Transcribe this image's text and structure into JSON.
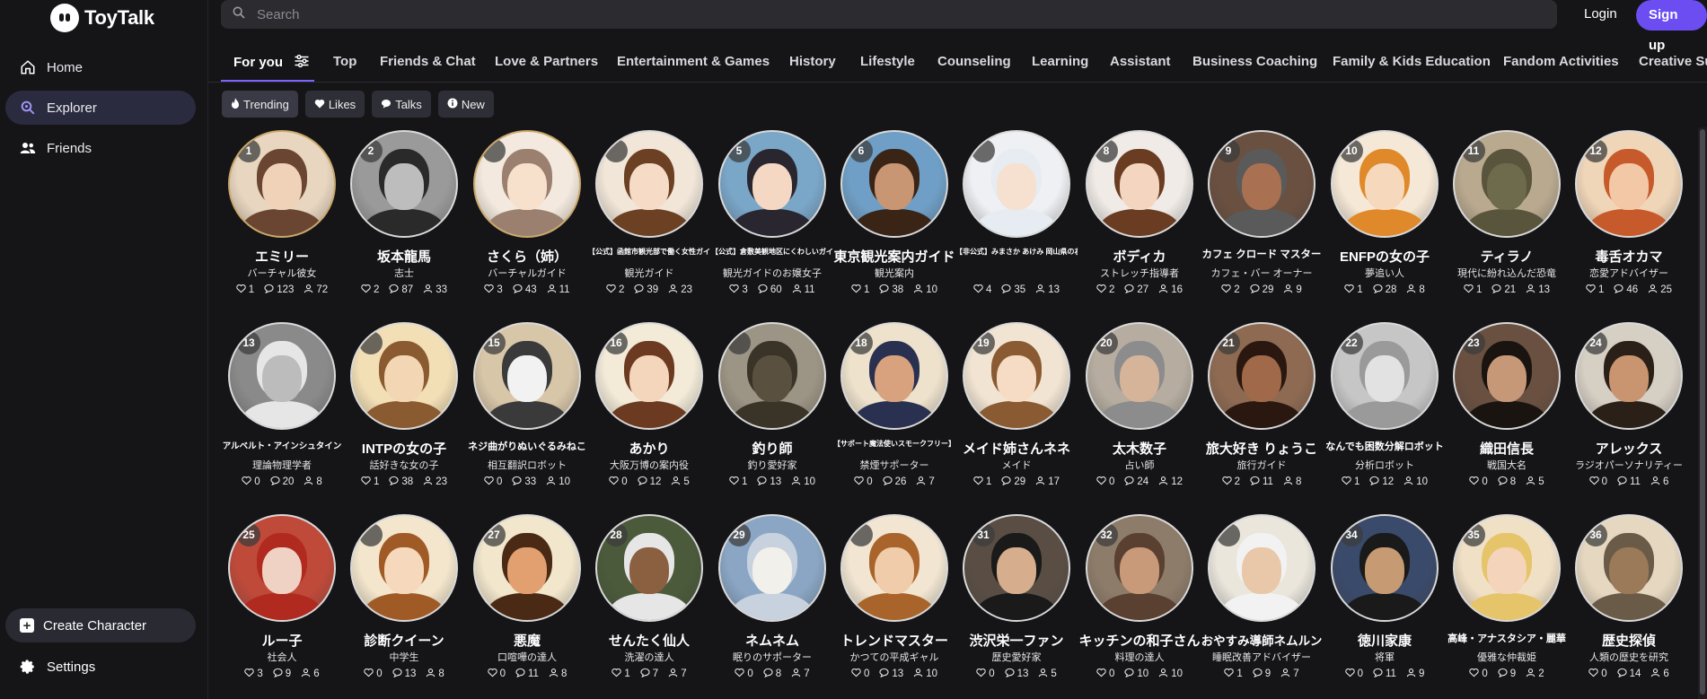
{
  "app": {
    "name": "ToyTalk"
  },
  "sidebar": {
    "items": [
      {
        "label": "Home",
        "icon": "home-icon"
      },
      {
        "label": "Explorer",
        "icon": "explore-icon",
        "active": true
      },
      {
        "label": "Friends",
        "icon": "friends-icon"
      }
    ],
    "create_label": "Create Character",
    "settings_label": "Settings"
  },
  "header": {
    "search_placeholder": "Search",
    "login_label": "Login",
    "signup_label": "Sign up",
    "accent_color": "#6b4df2"
  },
  "tabs": [
    "For you",
    "Top",
    "Friends & Chat",
    "Love & Partners",
    "Entertainment & Games",
    "History",
    "Lifestyle",
    "Counseling",
    "Learning",
    "Assistant",
    "Business Coaching",
    "Family & Kids Education",
    "Fandom Activities",
    "Creative Su"
  ],
  "filters": [
    {
      "label": "Trending",
      "icon": "flame-icon",
      "active": true
    },
    {
      "label": "Likes",
      "icon": "heart-icon"
    },
    {
      "label": "Talks",
      "icon": "chat-icon"
    },
    {
      "label": "New",
      "icon": "info-icon"
    }
  ],
  "characters": [
    {
      "rank": "1",
      "name": "エミリー",
      "role": "バーチャル彼女",
      "likes": "1",
      "talks": "123",
      "users": "72",
      "bg": "#e8d6c0",
      "skin": "#f0d2b8",
      "hair": "#6a4632",
      "gold": true
    },
    {
      "rank": "2",
      "name": "坂本龍馬",
      "role": "志士",
      "likes": "2",
      "talks": "87",
      "users": "33",
      "bg": "#9a9a9a",
      "skin": "#bdbdbd",
      "hair": "#2a2a2a"
    },
    {
      "rank": "",
      "name": "さくら（姉）",
      "role": "バーチャルガイド",
      "likes": "3",
      "talks": "43",
      "users": "11",
      "bg": "#f3e9de",
      "skin": "#f7e0cc",
      "hair": "#9b8070",
      "gold": true
    },
    {
      "rank": "",
      "name": "【公式】函館市観光部で働く女性ガイド",
      "role": "観光ガイド",
      "likes": "2",
      "talks": "39",
      "users": "23",
      "bg": "#f1e6d8",
      "skin": "#f6dcc6",
      "hair": "#6b4023"
    },
    {
      "rank": "5",
      "name": "【公式】倉敷美観地区にくわしいガイド",
      "role": "観光ガイドのお嬢女子",
      "likes": "3",
      "talks": "60",
      "users": "11",
      "bg": "#7aa6c8",
      "skin": "#f4d8c4",
      "hair": "#2a2630"
    },
    {
      "rank": "6",
      "name": "東京観光案内ガイド",
      "role": "観光案内",
      "likes": "1",
      "talks": "38",
      "users": "10",
      "bg": "#6f9fc6",
      "skin": "#c99674",
      "hair": "#3a2416"
    },
    {
      "rank": "",
      "name": "【非公式】みまさか あけみ 岡山県の右上の観光ガイド(…",
      "role": "",
      "likes": "4",
      "talks": "35",
      "users": "13",
      "bg": "#eef0f4",
      "skin": "#f6e0cf",
      "hair": "#e6ecf2"
    },
    {
      "rank": "8",
      "name": "ボディカ",
      "role": "ストレッチ指導者",
      "likes": "2",
      "talks": "27",
      "users": "16",
      "bg": "#f0ebe6",
      "skin": "#f4d6c0",
      "hair": "#6a3c22"
    },
    {
      "rank": "9",
      "name": "カフェ クロード マスター",
      "role": "カフェ・バー オーナー",
      "likes": "2",
      "talks": "29",
      "users": "9",
      "bg": "#6a5040",
      "skin": "#a97152",
      "hair": "#5a5a5a"
    },
    {
      "rank": "10",
      "name": "ENFPの女の子",
      "role": "夢追い人",
      "likes": "1",
      "talks": "28",
      "users": "8",
      "bg": "#f6e8d6",
      "skin": "#f6d8bc",
      "hair": "#e0892a"
    },
    {
      "rank": "11",
      "name": "ティラノ",
      "role": "現代に紛れ込んだ恐竜",
      "likes": "1",
      "talks": "21",
      "users": "13",
      "bg": "#b9a98f",
      "skin": "#6e6a4c",
      "hair": "#58553c"
    },
    {
      "rank": "12",
      "name": "毒舌オカマ",
      "role": "恋愛アドバイザー",
      "likes": "1",
      "talks": "46",
      "users": "25",
      "bg": "#f0d6b8",
      "skin": "#f2c8a6",
      "hair": "#c65a2a"
    },
    {
      "rank": "13",
      "name": "アルベルト・アインシュタイン",
      "role": "理論物理学者",
      "likes": "0",
      "talks": "20",
      "users": "8",
      "bg": "#8a8a8a",
      "skin": "#bcbcbc",
      "hair": "#e6e6e6"
    },
    {
      "rank": "",
      "name": "INTPの女の子",
      "role": "話好きな女の子",
      "likes": "1",
      "talks": "38",
      "users": "23",
      "bg": "#f3dfb6",
      "skin": "#f3d6b4",
      "hair": "#8a5a30"
    },
    {
      "rank": "15",
      "name": "ネジ曲がりぬいぐるみねこ",
      "role": "相互翻訳ロボット",
      "likes": "0",
      "talks": "33",
      "users": "10",
      "bg": "#d8c6a8",
      "skin": "#f2f2f2",
      "hair": "#3a3a3a"
    },
    {
      "rank": "16",
      "name": "あかり",
      "role": "大阪万博の案内役",
      "likes": "0",
      "talks": "12",
      "users": "5",
      "bg": "#f3ead8",
      "skin": "#f4d6bc",
      "hair": "#6b3a20"
    },
    {
      "rank": "",
      "name": "釣り師",
      "role": "釣り愛好家",
      "likes": "1",
      "talks": "13",
      "users": "10",
      "bg": "#9c9484",
      "skin": "#5a5040",
      "hair": "#3a3428"
    },
    {
      "rank": "18",
      "name": "【サポート魔法使いスモークフリー】",
      "role": "禁煙サポーター",
      "likes": "0",
      "talks": "26",
      "users": "7",
      "bg": "#eee2cc",
      "skin": "#d8a27e",
      "hair": "#2a3050"
    },
    {
      "rank": "19",
      "name": "メイド姉さんネネ",
      "role": "メイド",
      "likes": "1",
      "talks": "29",
      "users": "17",
      "bg": "#f1e4d2",
      "skin": "#f6dcc4",
      "hair": "#8a5a32"
    },
    {
      "rank": "20",
      "name": "太木数子",
      "role": "占い師",
      "likes": "0",
      "talks": "24",
      "users": "12",
      "bg": "#b6ada0",
      "skin": "#d6b49a",
      "hair": "#8c8c8c"
    },
    {
      "rank": "21",
      "name": "旅大好き りょうこ",
      "role": "旅行ガイド",
      "likes": "2",
      "talks": "11",
      "users": "8",
      "bg": "#8e6a52",
      "skin": "#a06a4a",
      "hair": "#2a1810"
    },
    {
      "rank": "22",
      "name": "なんでも困数分解ロボット",
      "role": "分析ロボット",
      "likes": "1",
      "talks": "12",
      "users": "10",
      "bg": "#c6c6c6",
      "skin": "#e2e2e2",
      "hair": "#9a9a9a"
    },
    {
      "rank": "23",
      "name": "織田信長",
      "role": "戦国大名",
      "likes": "0",
      "talks": "8",
      "users": "5",
      "bg": "#6a5040",
      "skin": "#c79878",
      "hair": "#1a1410"
    },
    {
      "rank": "24",
      "name": "アレックス",
      "role": "ラジオパーソナリティー",
      "likes": "0",
      "talks": "11",
      "users": "6",
      "bg": "#d6cfc4",
      "skin": "#c99470",
      "hair": "#2a2018"
    },
    {
      "rank": "25",
      "name": "ルー子",
      "role": "社会人",
      "likes": "3",
      "talks": "9",
      "users": "6",
      "bg": "#c04a3a",
      "skin": "#f0d2c4",
      "hair": "#b02a20"
    },
    {
      "rank": "",
      "name": "診断クイーン",
      "role": "中学生",
      "likes": "0",
      "talks": "13",
      "users": "8",
      "bg": "#f3e6cc",
      "skin": "#f6d8bc",
      "hair": "#a05a26"
    },
    {
      "rank": "27",
      "name": "悪魔",
      "role": "口喧嘩の達人",
      "likes": "0",
      "talks": "11",
      "users": "8",
      "bg": "#f2e6cc",
      "skin": "#e2a070",
      "hair": "#4a2a14"
    },
    {
      "rank": "28",
      "name": "せんたく仙人",
      "role": "洗濯の達人",
      "likes": "1",
      "talks": "7",
      "users": "7",
      "bg": "#4a5a3a",
      "skin": "#8a6040",
      "hair": "#e6e6e6"
    },
    {
      "rank": "29",
      "name": "ネムネム",
      "role": "眠りのサポーター",
      "likes": "0",
      "talks": "8",
      "users": "7",
      "bg": "#8aa6c4",
      "skin": "#f2f0ea",
      "hair": "#c8d2de"
    },
    {
      "rank": "",
      "name": "トレンドマスター",
      "role": "かつての平成ギャル",
      "likes": "0",
      "talks": "13",
      "users": "10",
      "bg": "#f2e6d2",
      "skin": "#f0ccaa",
      "hair": "#a8642a"
    },
    {
      "rank": "31",
      "name": "渋沢栄一ファン",
      "role": "歴史愛好家",
      "likes": "0",
      "talks": "13",
      "users": "5",
      "bg": "#5a4e44",
      "skin": "#d6ae8e",
      "hair": "#1a1a1a"
    },
    {
      "rank": "32",
      "name": "キッチンの和子さん",
      "role": "料理の達人",
      "likes": "0",
      "talks": "10",
      "users": "10",
      "bg": "#8e7c6a",
      "skin": "#c99a7a",
      "hair": "#5a4030"
    },
    {
      "rank": "",
      "name": "おやすみ導師ネムルン",
      "role": "睡眠改善アドバイザー",
      "likes": "1",
      "talks": "9",
      "users": "7",
      "bg": "#eae6dc",
      "skin": "#e8c8a8",
      "hair": "#f2f2f2"
    },
    {
      "rank": "34",
      "name": "徳川家康",
      "role": "将軍",
      "likes": "0",
      "talks": "11",
      "users": "9",
      "bg": "#3a4a6a",
      "skin": "#c69a72",
      "hair": "#1a1a1a"
    },
    {
      "rank": "35",
      "name": "高峰・アナスタシア・麗華",
      "role": "優雅な仲裁姫",
      "likes": "0",
      "talks": "9",
      "users": "2",
      "bg": "#f0e0c6",
      "skin": "#f4d4ba",
      "hair": "#e6c46a"
    },
    {
      "rank": "36",
      "name": "歴史探偵",
      "role": "人類の歴史を研究",
      "likes": "0",
      "talks": "14",
      "users": "6",
      "bg": "#e6d8c0",
      "skin": "#9a7a58",
      "hair": "#6a5a48"
    }
  ]
}
